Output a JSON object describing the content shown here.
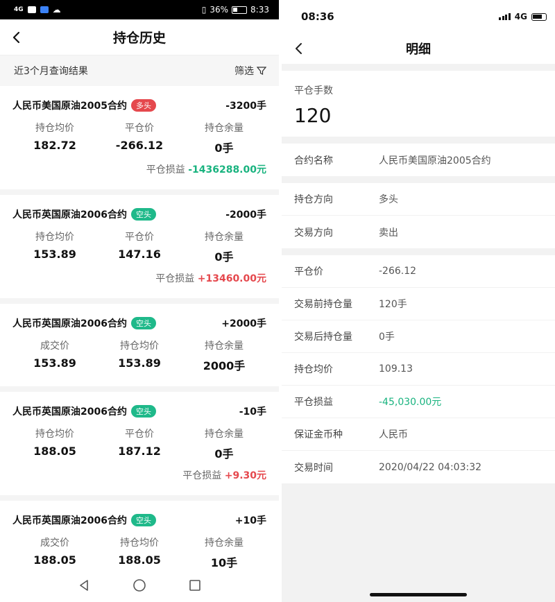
{
  "left_screen": {
    "status_bar": {
      "network": "4G",
      "battery": "36%",
      "time": "8:33"
    },
    "header": {
      "title": "持仓历史"
    },
    "filter_bar": {
      "summary": "近3个月查询结果",
      "filter_label": "筛选"
    },
    "cards": [
      {
        "name": "人民币美国原油2005合约",
        "badge": "多头",
        "badge_color": "#e5484d",
        "qty": "-3200手",
        "cols": [
          {
            "label": "持仓均价",
            "value": "182.72"
          },
          {
            "label": "平仓价",
            "value": "-266.12"
          },
          {
            "label": "持仓余量",
            "value": "0手"
          }
        ],
        "pnl_label": "平仓损益",
        "pnl_value": "-1436288.00元",
        "pnl_color": "#19b37f"
      },
      {
        "name": "人民币英国原油2006合约",
        "badge": "空头",
        "badge_color": "#1fb98a",
        "qty": "-2000手",
        "cols": [
          {
            "label": "持仓均价",
            "value": "153.89"
          },
          {
            "label": "平仓价",
            "value": "147.16"
          },
          {
            "label": "持仓余量",
            "value": "0手"
          }
        ],
        "pnl_label": "平仓损益",
        "pnl_value": "+13460.00元",
        "pnl_color": "#e5484d"
      },
      {
        "name": "人民币英国原油2006合约",
        "badge": "空头",
        "badge_color": "#1fb98a",
        "qty": "+2000手",
        "cols": [
          {
            "label": "成交价",
            "value": "153.89"
          },
          {
            "label": "持仓均价",
            "value": "153.89"
          },
          {
            "label": "持仓余量",
            "value": "2000手"
          }
        ]
      },
      {
        "name": "人民币英国原油2006合约",
        "badge": "空头",
        "badge_color": "#1fb98a",
        "qty": "-10手",
        "cols": [
          {
            "label": "持仓均价",
            "value": "188.05"
          },
          {
            "label": "平仓价",
            "value": "187.12"
          },
          {
            "label": "持仓余量",
            "value": "0手"
          }
        ],
        "pnl_label": "平仓损益",
        "pnl_value": "+9.30元",
        "pnl_color": "#e5484d"
      },
      {
        "name": "人民币英国原油2006合约",
        "badge": "空头",
        "badge_color": "#1fb98a",
        "qty": "+10手",
        "cols": [
          {
            "label": "成交价",
            "value": "188.05"
          },
          {
            "label": "持仓均价",
            "value": "188.05"
          },
          {
            "label": "持仓余量",
            "value": "10手"
          }
        ]
      }
    ]
  },
  "right_screen": {
    "status_bar": {
      "time": "08:36",
      "network": "4G"
    },
    "header": {
      "title": "明细"
    },
    "close_qty": {
      "label": "平仓手数",
      "value": "120"
    },
    "rows": [
      {
        "group": 1,
        "key": "合约名称",
        "value": "人民币美国原油2005合约"
      },
      {
        "group": 2,
        "key": "持仓方向",
        "value": "多头"
      },
      {
        "group": 2,
        "key": "交易方向",
        "value": "卖出"
      },
      {
        "group": 3,
        "key": "平仓价",
        "value": "-266.12"
      },
      {
        "group": 3,
        "key": "交易前持仓量",
        "value": "120手"
      },
      {
        "group": 3,
        "key": "交易后持仓量",
        "value": "0手"
      },
      {
        "group": 3,
        "key": "持仓均价",
        "value": "109.13"
      },
      {
        "group": 3,
        "key": "平仓损益",
        "value": "-45,030.00元",
        "color": "#19b37f"
      },
      {
        "group": 3,
        "key": "保证金币种",
        "value": "人民币"
      },
      {
        "group": 3,
        "key": "交易时间",
        "value": "2020/04/22 04:03:32"
      }
    ]
  }
}
